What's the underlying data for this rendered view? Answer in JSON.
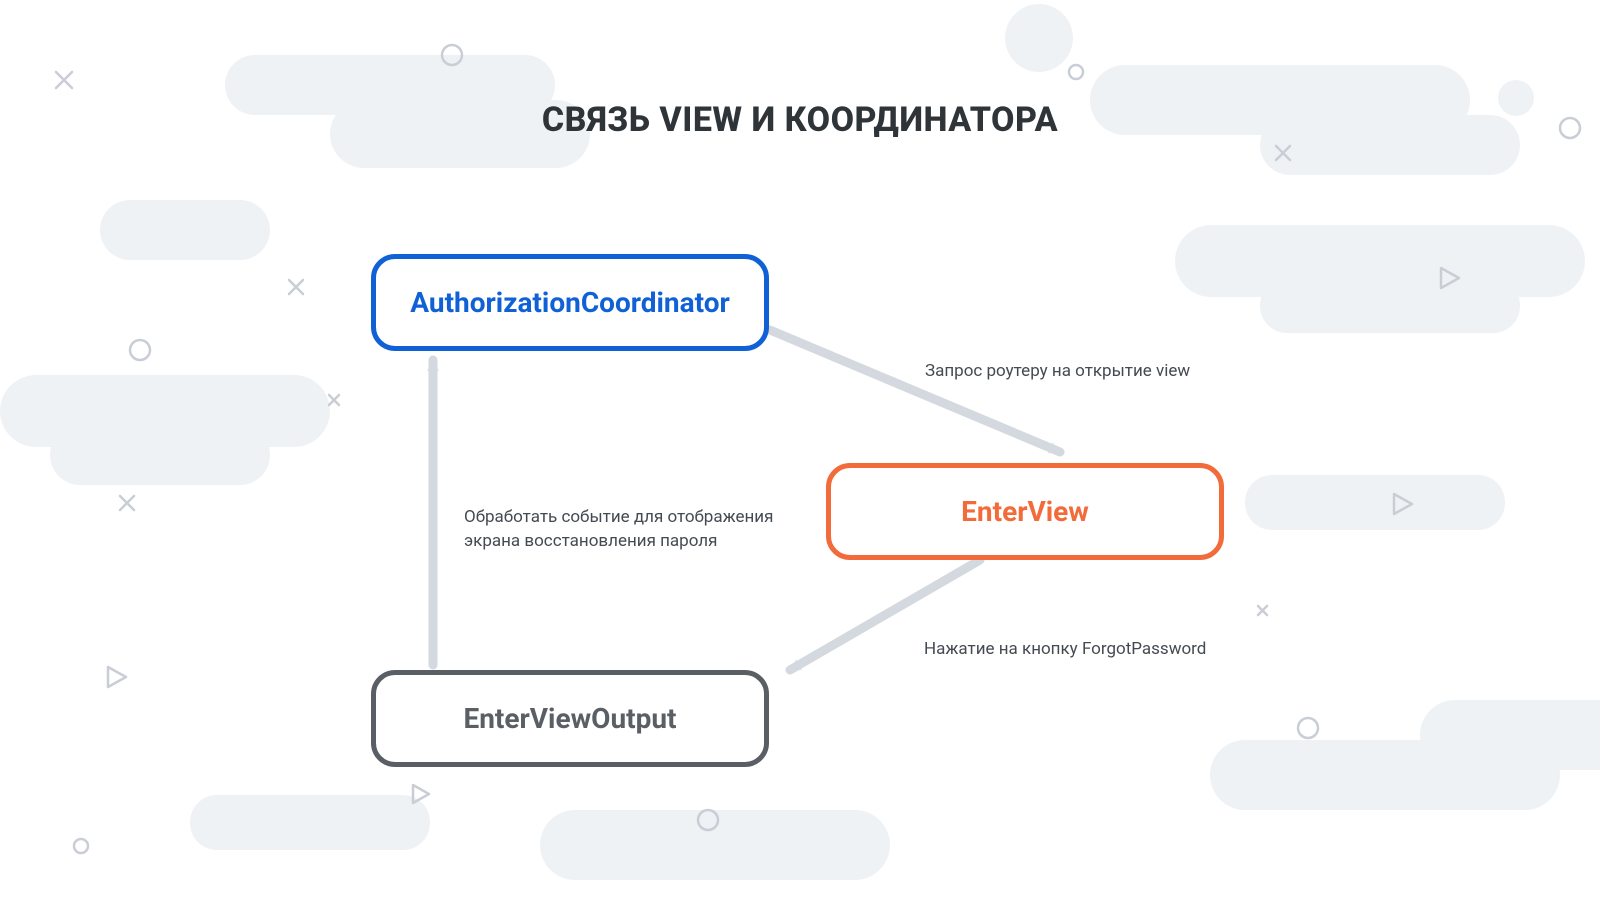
{
  "title": "СВЯЗЬ VIEW И КООРДИНАТОРА",
  "nodes": {
    "coord": "AuthorizationCoordinator",
    "view": "EnterView",
    "output": "EnterViewOutput"
  },
  "labels": {
    "toView": "Запрос роутеру на открытие view",
    "toOutput": "Нажатие на кнопку ForgotPassword",
    "toCoordLine1": "Обработать событие для отображения",
    "toCoordLine2": "экрана восстановления пароля"
  },
  "colors": {
    "blue": "#1161d6",
    "orange": "#f26b3a",
    "gray": "#5a5f66",
    "arrow": "#d3d9df",
    "cloud": "#eff2f5",
    "deco": "#c9ced6"
  }
}
